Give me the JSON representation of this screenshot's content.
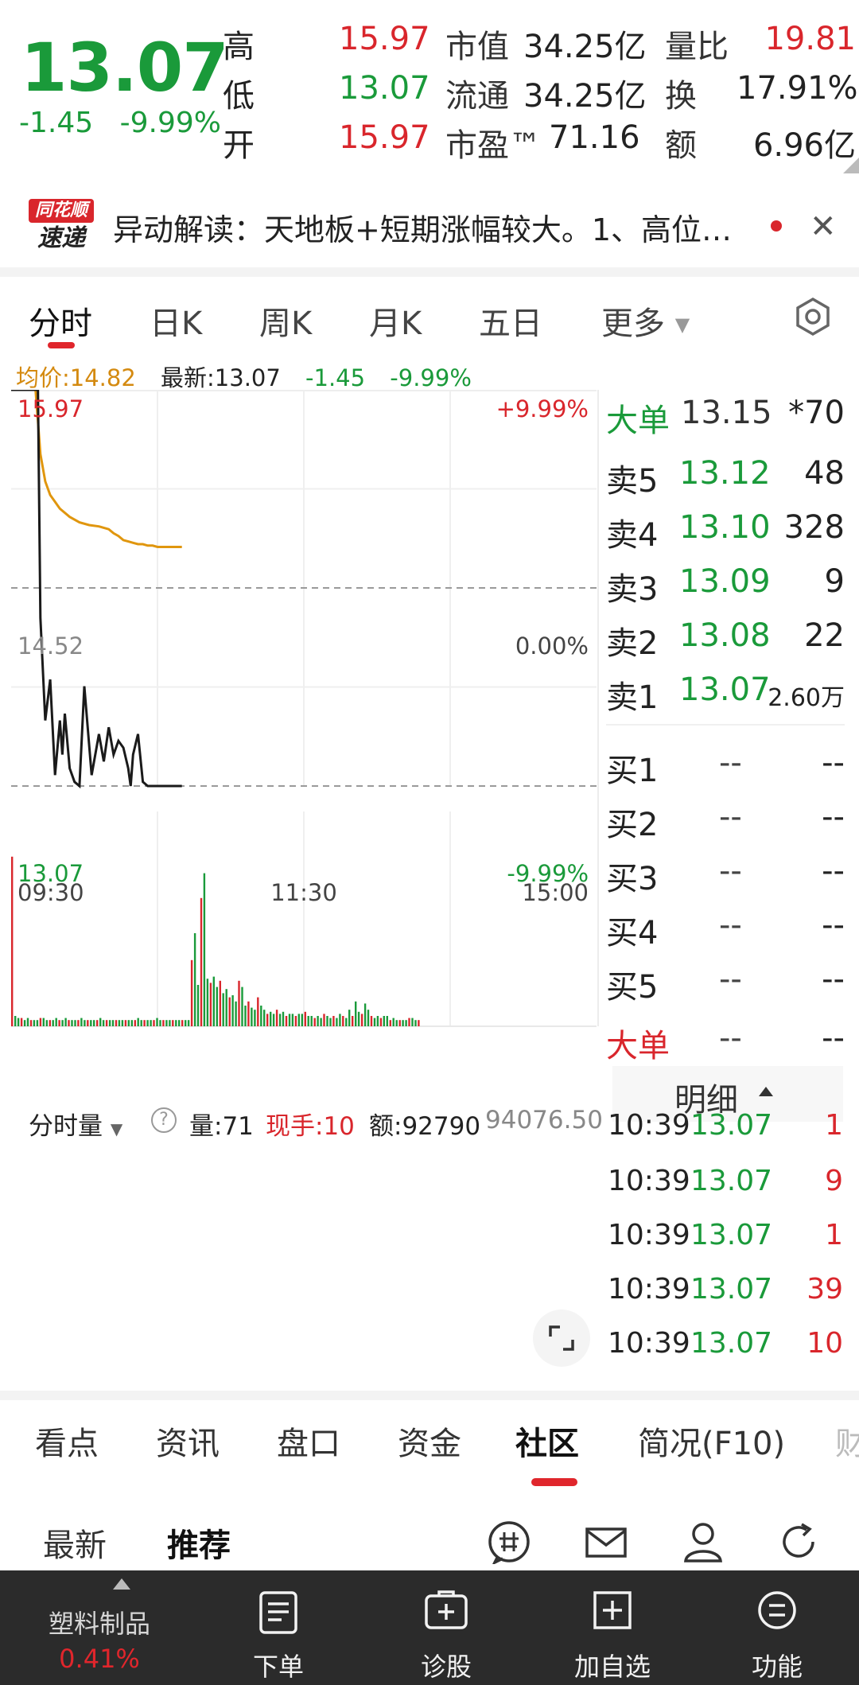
{
  "quote": {
    "last": "13.07",
    "change": "-1.45",
    "change_pct": "-9.99%",
    "stats": [
      {
        "label": "高",
        "value": "15.97",
        "color": "#d9262c"
      },
      {
        "label": "低",
        "value": "13.07",
        "color": "#1a9a3a"
      },
      {
        "label": "开",
        "value": "15.97",
        "color": "#d9262c"
      }
    ],
    "cap": [
      {
        "label": "市值",
        "value": "34.25亿"
      },
      {
        "label": "流通",
        "value": "34.25亿"
      },
      {
        "label": "市盈™",
        "value": "71.16"
      }
    ],
    "ratio": [
      {
        "label": "量比",
        "value": "19.81",
        "color": "#d9262c"
      },
      {
        "label": "换",
        "value": "17.91%",
        "color": "#222222"
      },
      {
        "label": "额",
        "value": "6.96亿",
        "color": "#222222"
      }
    ]
  },
  "alert": {
    "logo_top": "同花顺",
    "logo_bottom": "速递",
    "text": "异动解读：天地板+短期涨幅较大。1、高位…"
  },
  "chart_tabs": [
    "分时",
    "日K",
    "周K",
    "月K",
    "五日",
    "更多"
  ],
  "price_info": {
    "avg": "均价:14.82",
    "latest": "最新:13.07",
    "change": "-1.45",
    "change_pct": "-9.99%"
  },
  "order_book": {
    "big_sell": {
      "label": "大单",
      "price": "13.15",
      "vol": "*70"
    },
    "asks": [
      {
        "label": "卖5",
        "price": "13.12",
        "vol": "48"
      },
      {
        "label": "卖4",
        "price": "13.10",
        "vol": "328"
      },
      {
        "label": "卖3",
        "price": "13.09",
        "vol": "9"
      },
      {
        "label": "卖2",
        "price": "13.08",
        "vol": "22"
      },
      {
        "label": "卖1",
        "price": "13.07",
        "vol": "2.60万"
      }
    ],
    "bids": [
      {
        "label": "买1",
        "price": "--",
        "vol": "--"
      },
      {
        "label": "买2",
        "price": "--",
        "vol": "--"
      },
      {
        "label": "买3",
        "price": "--",
        "vol": "--"
      },
      {
        "label": "买4",
        "price": "--",
        "vol": "--"
      },
      {
        "label": "买5",
        "price": "--",
        "vol": "--"
      }
    ],
    "big_buy": {
      "label": "大单",
      "price": "--",
      "vol": "--"
    }
  },
  "volume_bar": {
    "mode": "分时量",
    "help": "?",
    "amount": "量:71",
    "current_hand": "现手:10",
    "money": "额:92790",
    "max": "94076.50"
  },
  "detail": {
    "title": "明细",
    "rows": [
      {
        "time": "10:39",
        "price": "13.07",
        "vol": "1"
      },
      {
        "time": "10:39",
        "price": "13.07",
        "vol": "9"
      },
      {
        "time": "10:39",
        "price": "13.07",
        "vol": "1"
      },
      {
        "time": "10:39",
        "price": "13.07",
        "vol": "39"
      },
      {
        "time": "10:39",
        "price": "13.07",
        "vol": "10"
      }
    ]
  },
  "info_tabs": [
    "看点",
    "资讯",
    "盘口",
    "资金",
    "社区",
    "简况(F10)",
    "财"
  ],
  "community_tabs": [
    "最新",
    "推荐"
  ],
  "bottom_nav": {
    "sector_name": "塑料制品",
    "sector_pct": "0.41%",
    "items": [
      "下单",
      "诊股",
      "加自选",
      "功能"
    ]
  },
  "chart_data": {
    "type": "line",
    "x_ticks": [
      "09:30",
      "11:30",
      "15:00"
    ],
    "y_left_ticks": [
      "15.97",
      "14.52",
      "13.07"
    ],
    "y_right_ticks": [
      "+9.99%",
      "0.00%",
      "-9.99%"
    ],
    "ylim": [
      13.07,
      15.97
    ],
    "minutes_total": 240,
    "series": [
      {
        "values_x": [
          0,
          4,
          6,
          8,
          10,
          11,
          12,
          14,
          16,
          18,
          20,
          21,
          22,
          24,
          26,
          28,
          30,
          33,
          36,
          38,
          40,
          42,
          44,
          46,
          48,
          49,
          50,
          52,
          54,
          56,
          58,
          60,
          62,
          64,
          66,
          68,
          70
        ],
        "values_y": [
          15.97,
          15.97,
          15.97,
          15.97,
          15.97,
          15.97,
          14.3,
          13.55,
          13.85,
          13.15,
          13.55,
          13.3,
          13.6,
          13.2,
          13.1,
          13.07,
          13.8,
          13.15,
          13.45,
          13.25,
          13.5,
          13.3,
          13.4,
          13.35,
          13.2,
          13.07,
          13.3,
          13.45,
          13.1,
          13.07,
          13.07,
          13.07,
          13.07,
          13.07,
          13.07,
          13.07,
          13.07
        ]
      },
      {
        "values_x": [
          0,
          10,
          12,
          14,
          16,
          18,
          20,
          24,
          28,
          32,
          36,
          40,
          42,
          44,
          46,
          48,
          50,
          52,
          54,
          56,
          58,
          60,
          62,
          66,
          70
        ],
        "values_y": [
          15.97,
          15.97,
          15.5,
          15.3,
          15.2,
          15.15,
          15.1,
          15.04,
          15.0,
          14.98,
          14.97,
          14.95,
          14.92,
          14.9,
          14.87,
          14.86,
          14.85,
          14.84,
          14.84,
          14.83,
          14.83,
          14.82,
          14.82,
          14.82,
          14.82
        ]
      }
    ],
    "volume": [
      0.82,
      0.05,
      0.04,
      0.04,
      0.03,
      0.04,
      0.03,
      0.03,
      0.03,
      0.04,
      0.04,
      0.03,
      0.03,
      0.03,
      0.04,
      0.03,
      0.03,
      0.04,
      0.03,
      0.03,
      0.03,
      0.03,
      0.04,
      0.03,
      0.03,
      0.03,
      0.03,
      0.03,
      0.04,
      0.03,
      0.03,
      0.03,
      0.03,
      0.03,
      0.03,
      0.03,
      0.03,
      0.03,
      0.03,
      0.03,
      0.04,
      0.03,
      0.03,
      0.03,
      0.03,
      0.03,
      0.04,
      0.03,
      0.03,
      0.03,
      0.03,
      0.03,
      0.03,
      0.03,
      0.03,
      0.03,
      0.03,
      0.32,
      0.45,
      0.2,
      0.62,
      0.74,
      0.23,
      0.21,
      0.24,
      0.19,
      0.22,
      0.16,
      0.18,
      0.14,
      0.15,
      0.12,
      0.22,
      0.19,
      0.1,
      0.12,
      0.09,
      0.08,
      0.14,
      0.1,
      0.08,
      0.06,
      0.07,
      0.06,
      0.08,
      0.06,
      0.07,
      0.05,
      0.06,
      0.06,
      0.05,
      0.06,
      0.06,
      0.07,
      0.05,
      0.05,
      0.04,
      0.05,
      0.04,
      0.06,
      0.05,
      0.04,
      0.05,
      0.04,
      0.06,
      0.05,
      0.04,
      0.08,
      0.05,
      0.12,
      0.07,
      0.06,
      0.11,
      0.08,
      0.05,
      0.04,
      0.05,
      0.04,
      0.05,
      0.05,
      0.03,
      0.04,
      0.03,
      0.03,
      0.03,
      0.03,
      0.04,
      0.04,
      0.03,
      0.03
    ]
  },
  "colors": {
    "up": "#d9262c",
    "down": "#1a9a3a",
    "avg_line": "#e0960e",
    "accent": "#e0262c"
  }
}
